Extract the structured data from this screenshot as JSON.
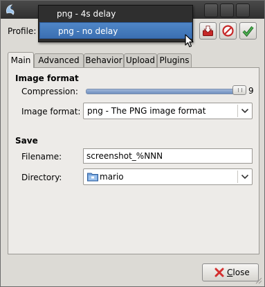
{
  "colors": {
    "titlebar": "#3a3a3a",
    "popup_background": "#2f2f2f",
    "selection": "#3b6fb2",
    "window_background": "#dcdad5",
    "panel_background": "#edebe8"
  },
  "profile": {
    "label": "Profile:",
    "dropdown_items": [
      {
        "label": "png - 4s delay",
        "selected": false
      },
      {
        "label": "png - no delay",
        "selected": true
      }
    ],
    "actions": [
      {
        "icon": "save-profile-icon"
      },
      {
        "icon": "delete-profile-icon"
      },
      {
        "icon": "apply-profile-icon"
      }
    ]
  },
  "tabs": [
    {
      "label": "Main",
      "active": true
    },
    {
      "label": "Advanced",
      "active": false
    },
    {
      "label": "Behavior",
      "active": false
    },
    {
      "label": "Upload",
      "active": false
    },
    {
      "label": "Plugins",
      "active": false
    }
  ],
  "main": {
    "image_format_section": {
      "title": "Image format",
      "compression_label": "Compression:",
      "compression_value": "9",
      "compression_level": 9,
      "compression_max": 9,
      "format_label": "Image format:",
      "format_value": "png - The PNG image format"
    },
    "save_section": {
      "title": "Save",
      "filename_label": "Filename:",
      "filename_value": "screenshot_%NNN",
      "directory_label": "Directory:",
      "directory_value": "mario",
      "directory_icon": "folder-icon"
    }
  },
  "footer": {
    "close_label": "Close",
    "close_mnemonic": "C"
  }
}
